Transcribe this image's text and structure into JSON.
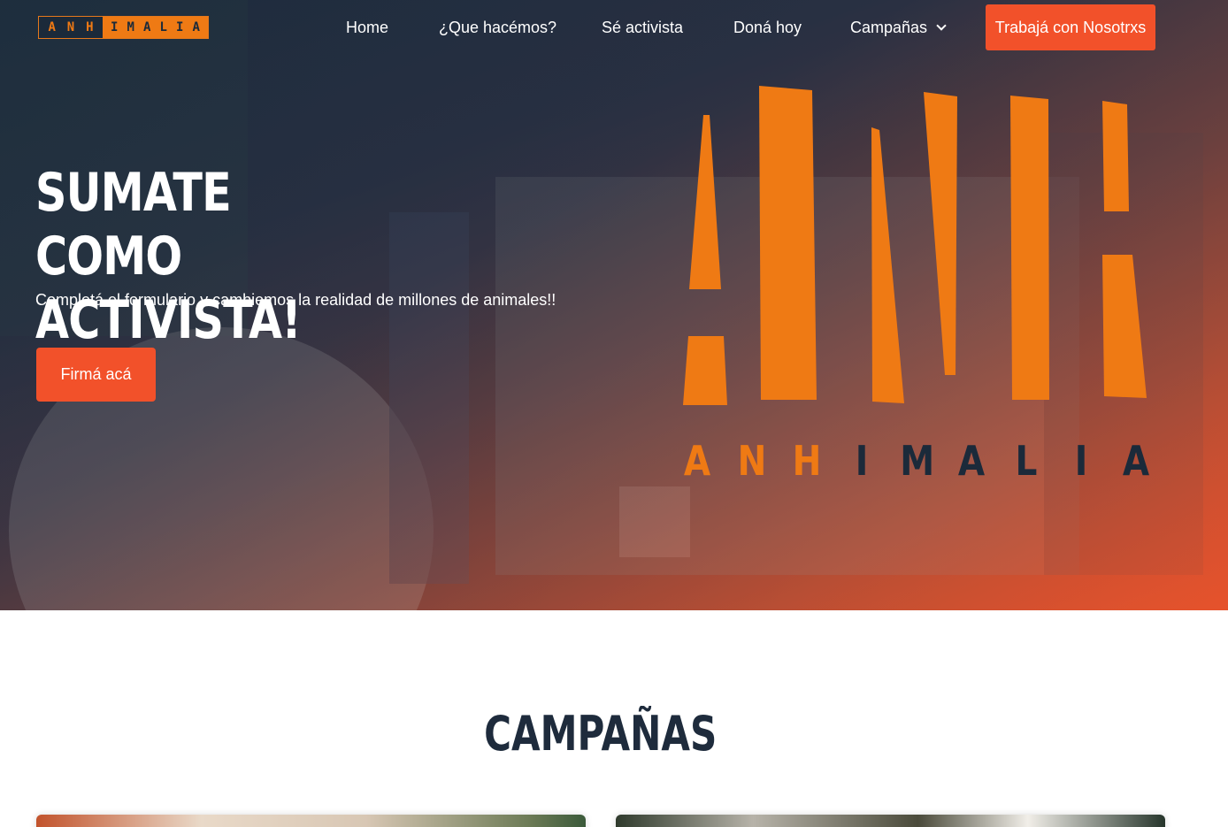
{
  "brand": {
    "logo_letters_dark_part": [
      "A",
      "N",
      "H"
    ],
    "logo_letters_light_part": [
      "I",
      "M",
      "A",
      "L",
      "I",
      "A"
    ],
    "accent_color": "#f2512a",
    "logo_orange": "#ef7a14",
    "logo_navy": "#1b2a3a"
  },
  "nav": {
    "items": [
      {
        "label": "Home"
      },
      {
        "label": "¿Que hacémos?"
      },
      {
        "label": "Sé activista"
      },
      {
        "label": "Doná hoy"
      },
      {
        "label": "Campañas",
        "icon": "chevron-down-icon"
      }
    ],
    "cta_label": "Trabajá con Nosotrxs"
  },
  "hero": {
    "title_line1": "SUMATE COMO",
    "title_line2": "ACTIVISTA!",
    "subtitle": "Completá el formulario y cambiemos la realidad de millones de animales!!",
    "button_label": "Firmá acá",
    "big_logo_word_orange": [
      "A",
      "N",
      "H"
    ],
    "big_logo_word_navy": [
      "I",
      "M",
      "A",
      "L",
      "I",
      "A"
    ]
  },
  "campaigns": {
    "title": "CAMPAÑAS"
  }
}
